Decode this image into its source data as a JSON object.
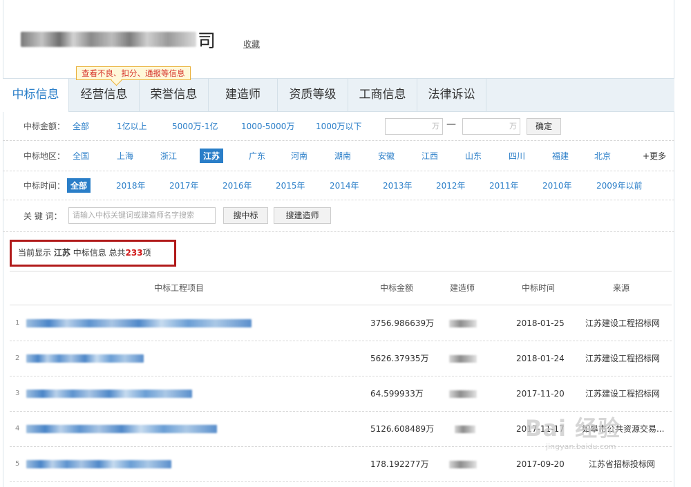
{
  "header": {
    "company_suffix": "司",
    "favorite_label": "收藏",
    "tooltip": "查看不良、扣分、通报等信息"
  },
  "tabs": [
    "中标信息",
    "经营信息",
    "荣誉信息",
    "建造师",
    "资质等级",
    "工商信息",
    "法律诉讼"
  ],
  "filters": {
    "amount": {
      "label": "中标金额：",
      "options": [
        "全部",
        "1亿以上",
        "5000万-1亿",
        "1000-5000万",
        "1000万以下"
      ],
      "unit": "万",
      "dash": "—",
      "confirm": "确定"
    },
    "region": {
      "label": "中标地区：",
      "options": [
        "全国",
        "上海",
        "浙江",
        "江苏",
        "广东",
        "河南",
        "湖南",
        "安徽",
        "江西",
        "山东",
        "四川",
        "福建",
        "北京"
      ],
      "selected": "江苏",
      "more": "+更多"
    },
    "time": {
      "label": "中标时间：",
      "options": [
        "全部",
        "2018年",
        "2017年",
        "2016年",
        "2015年",
        "2014年",
        "2013年",
        "2012年",
        "2011年",
        "2010年",
        "2009年以前"
      ],
      "selected": "全部"
    },
    "keyword": {
      "label": "关 键 词：",
      "placeholder": "请输入中标关键词或建造师名字搜索",
      "search_bid": "搜中标",
      "search_architect": "搜建造师"
    }
  },
  "summary": {
    "prefix": "当前显示",
    "region": "江苏",
    "middle": "中标信息 总共",
    "count": "233",
    "suffix": "项"
  },
  "table": {
    "headers": [
      "中标工程项目",
      "中标金额",
      "建造师",
      "中标时间",
      "来源"
    ],
    "rows": [
      {
        "num": "1",
        "amount": "3756.986639万",
        "date": "2018-01-25",
        "source": "江苏建设工程招标网"
      },
      {
        "num": "2",
        "amount": "5626.37935万",
        "date": "2018-01-24",
        "source": "江苏建设工程招标网"
      },
      {
        "num": "3",
        "amount": "64.599933万",
        "date": "2017-11-20",
        "source": "江苏建设工程招标网"
      },
      {
        "num": "4",
        "amount": "5126.608489万",
        "date": "2017-11-17",
        "source": "如皋市公共资源交易..."
      },
      {
        "num": "5",
        "amount": "178.192277万",
        "date": "2017-09-20",
        "source": "江苏省招标投标网"
      }
    ]
  },
  "watermark": {
    "main": "Bai 经验",
    "sub": "jingyan.baidu.com"
  }
}
